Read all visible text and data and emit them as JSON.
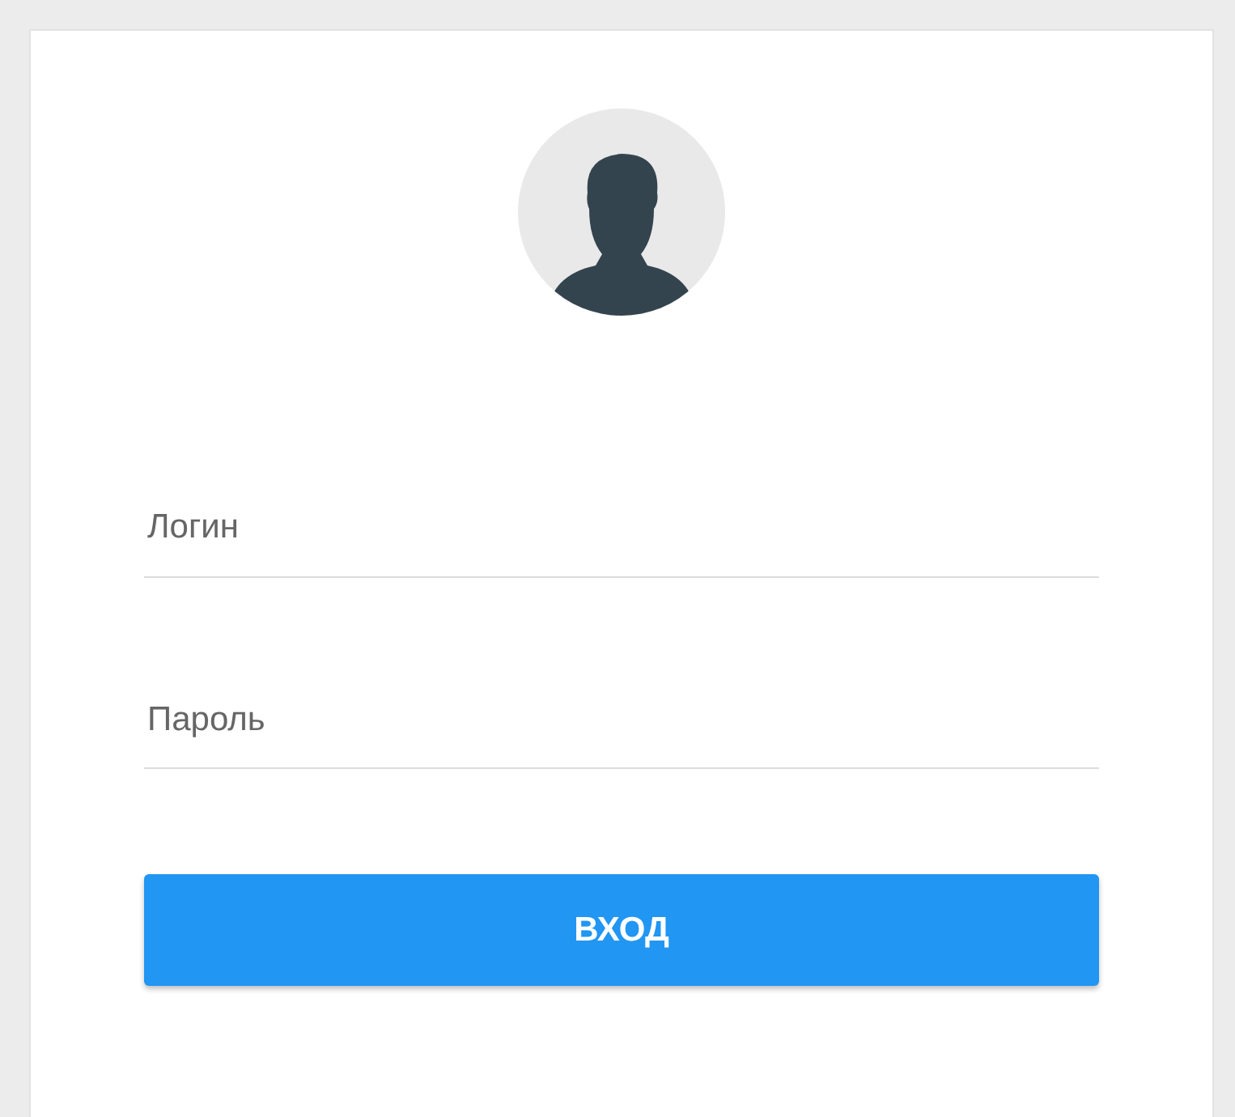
{
  "login_form": {
    "login": {
      "placeholder": "Логин"
    },
    "password": {
      "placeholder": "Пароль"
    },
    "submit": "ВХОД"
  }
}
